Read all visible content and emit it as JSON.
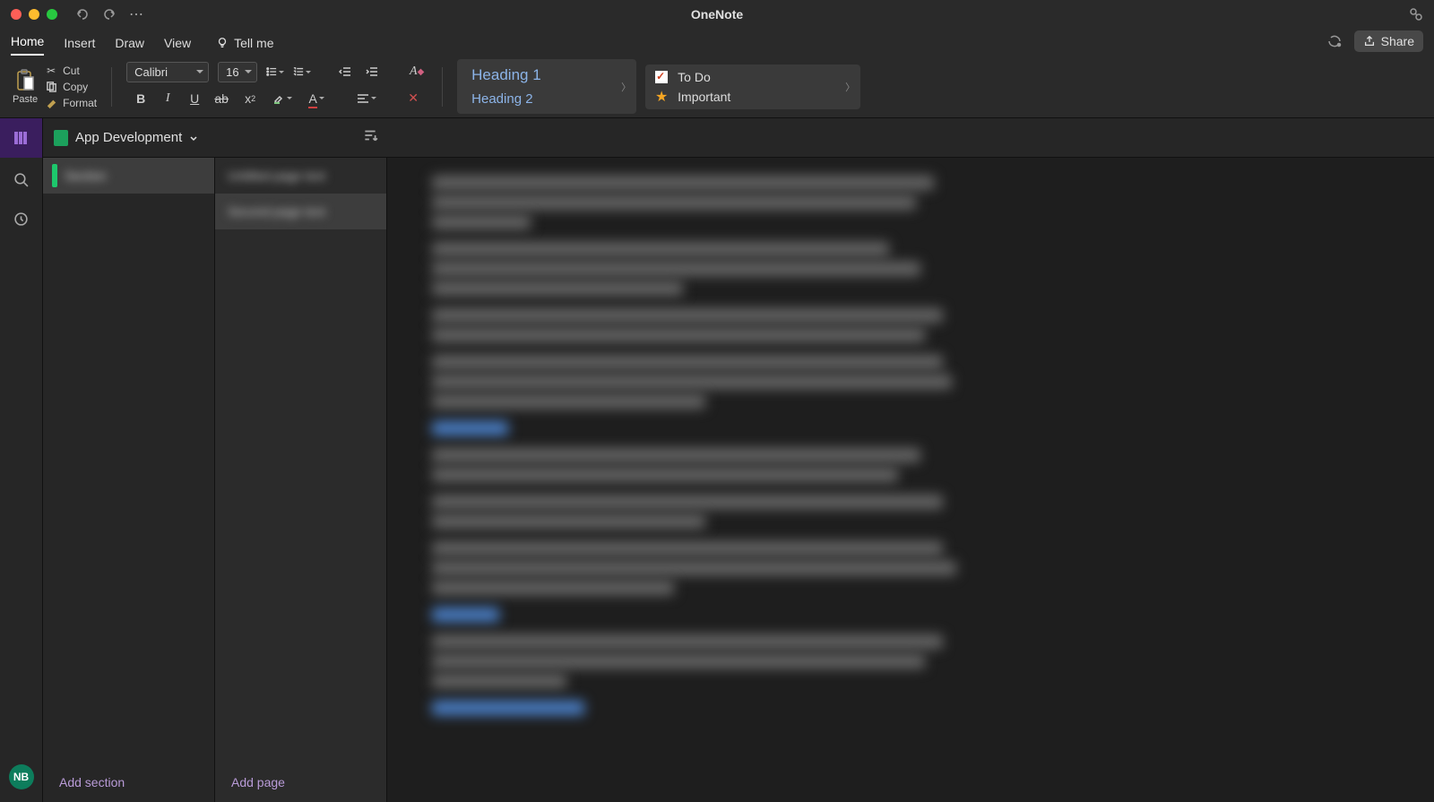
{
  "window": {
    "title": "OneNote"
  },
  "tabs": {
    "items": [
      "Home",
      "Insert",
      "Draw",
      "View"
    ],
    "active": "Home",
    "tellme": "Tell me"
  },
  "share": {
    "label": "Share"
  },
  "ribbon": {
    "paste": "Paste",
    "cut": "Cut",
    "copy": "Copy",
    "format": "Format",
    "font_name": "Calibri",
    "font_size": "16",
    "styles": {
      "h1": "Heading 1",
      "h2": "Heading 2"
    },
    "tags": {
      "todo": "To Do",
      "important": "Important"
    }
  },
  "notebook": {
    "name": "App Development"
  },
  "sidebar": {
    "section_blur": "Section",
    "page1_blur": "Untitled page text",
    "page2_blur": "Second page text",
    "add_section": "Add section",
    "add_page": "Add page"
  },
  "avatar": {
    "initials": "NB"
  },
  "content_widths": {
    "p1": [
      560,
      540,
      110
    ],
    "p2": [
      510,
      545,
      280
    ],
    "p3": [
      570,
      550
    ],
    "p4": [
      570,
      580,
      305
    ],
    "h1": [
      85
    ],
    "p5": [
      545,
      520
    ],
    "p6": [
      570,
      305
    ],
    "p7": [
      570,
      585,
      270
    ],
    "h2": [
      75
    ],
    "p8": [
      570,
      550,
      150
    ],
    "h3": [
      170
    ]
  }
}
